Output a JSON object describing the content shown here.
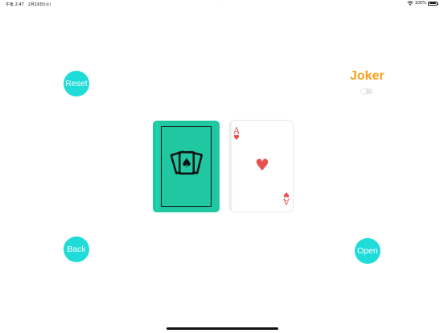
{
  "status_bar": {
    "time": "午後 2:47",
    "date": "2月16日(火)",
    "multitask_dots": "···",
    "battery_text": "100%",
    "battery_level_percent": 100
  },
  "controls": {
    "reset_label": "Reset",
    "back_label": "Back",
    "open_label": "Open",
    "joker_label": "Joker",
    "joker_enabled": false
  },
  "cards": {
    "back": {
      "suit_symbol": "♠"
    },
    "face": {
      "rank": "A",
      "suit_symbol": "♥",
      "suit": "hearts"
    }
  },
  "colors": {
    "button": "#1fdcd8",
    "joker": "#f3a21b",
    "card_back": "#20c7a0",
    "heart": "#e4524e"
  },
  "icons": {
    "wifi": "wifi-icon",
    "battery": "battery-icon",
    "card_back_emblem": "playing-cards-icon"
  }
}
